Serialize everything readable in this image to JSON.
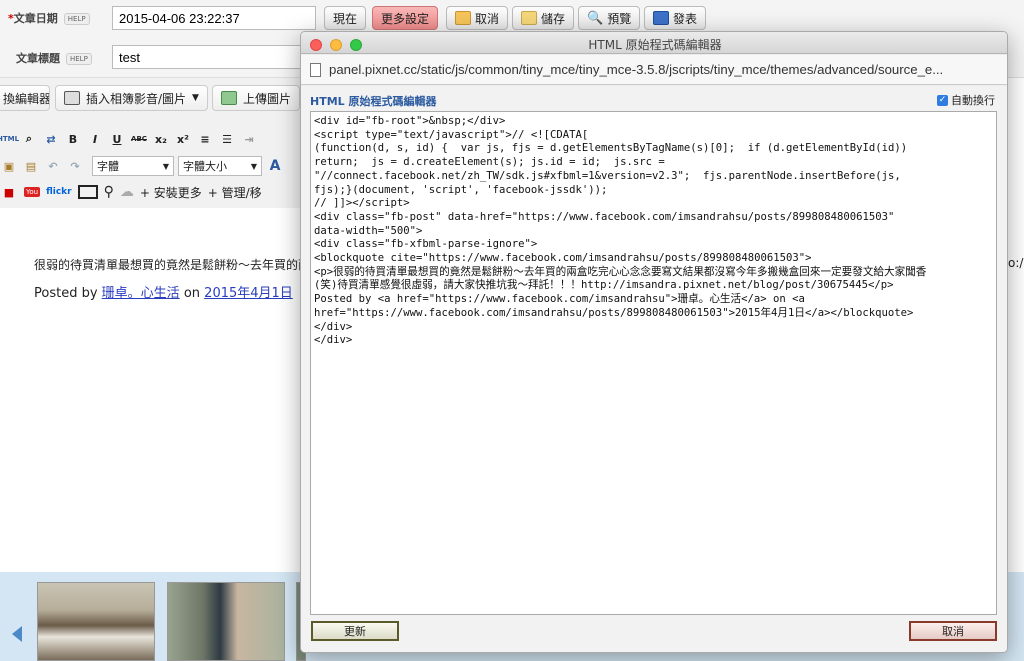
{
  "form": {
    "date_label": "文章日期",
    "date_required": "*",
    "help": "HELP",
    "date_value": "2015-04-06 23:22:37",
    "now_button": "現在",
    "more_settings": "更多設定",
    "cancel": "取消",
    "save": "儲存",
    "preview": "預覽",
    "publish": "發表",
    "title_label": "文章標題",
    "title_value": "test"
  },
  "toolbar": {
    "switch_editor": "換編輯器",
    "insert_media": "插入相簿影音/圖片",
    "upload_image": "上傳圖片",
    "html_icon": "HTML",
    "font_select": "字體",
    "font_size_select": "字體大小",
    "bold": "B",
    "italic": "I",
    "underline": "U",
    "strike": "ABC",
    "subscript": "x₂",
    "superscript": "x²",
    "install_more": "安裝更多",
    "manage": "管理/移",
    "flickr": "flickr",
    "youtube": "You"
  },
  "content": {
    "paragraph": "很弱的待買清單最想買的竟然是鬆餅粉～去年買的兩",
    "posted_by": "Posted by",
    "author_link": "珊卓。心生活",
    "on": "on",
    "date_link": "2015年4月1日",
    "right_overflow": "o:/"
  },
  "dialog": {
    "window_title": "HTML 原始程式碼編輯器",
    "url": "panel.pixnet.cc/static/js/common/tiny_mce/tiny_mce-3.5.8/jscripts/tiny_mce/themes/advanced/source_e...",
    "editor_heading": "HTML 原始程式碼編輯器",
    "wrap_label": "自動換行",
    "wrap_checked": true,
    "update_button": "更新",
    "cancel_button": "取消",
    "code_lines": [
      "<div id=\"fb-root\">&nbsp;</div>",
      "<script type=\"text/javascript\">// <![CDATA[",
      "(function(d, s, id) {  var js, fjs = d.getElementsByTagName(s)[0];  if (d.getElementById(id))",
      "return;  js = d.createElement(s); js.id = id;  js.src =",
      "\"//connect.facebook.net/zh_TW/sdk.js#xfbml=1&version=v2.3\";  fjs.parentNode.insertBefore(js,",
      "fjs);}(document, 'script', 'facebook-jssdk'));",
      "// ]]></script>",
      "<div class=\"fb-post\" data-href=\"https://www.facebook.com/imsandrahsu/posts/899808480061503\"",
      "data-width=\"500\">",
      "<div class=\"fb-xfbml-parse-ignore\">",
      "<blockquote cite=\"https://www.facebook.com/imsandrahsu/posts/899808480061503\">",
      "<p>很弱的待買清單最想買的竟然是鬆餅粉～去年買的兩盒吃完心心念念要寫文結果都沒寫今年多搬幾盒回來一定要發文給大家聞香",
      "(笑)待買清單感覺很虛弱，請大家快推坑我～拜託！！！http://imsandra.pixnet.net/blog/post/30675445</p>",
      "Posted by <a href=\"https://www.facebook.com/imsandrahsu\">珊卓。心生活</a> on <a",
      "href=\"https://www.facebook.com/imsandrahsu/posts/899808480061503\">2015年4月1日</a></blockquote>",
      "</div>",
      "</div>"
    ]
  },
  "colors": {
    "accent_blue": "#2c5aa0",
    "link": "#2a3dbf",
    "red_button": "#f08a8a",
    "close": "#fc605b",
    "minimize": "#fdbc40",
    "zoom": "#34c84a"
  }
}
